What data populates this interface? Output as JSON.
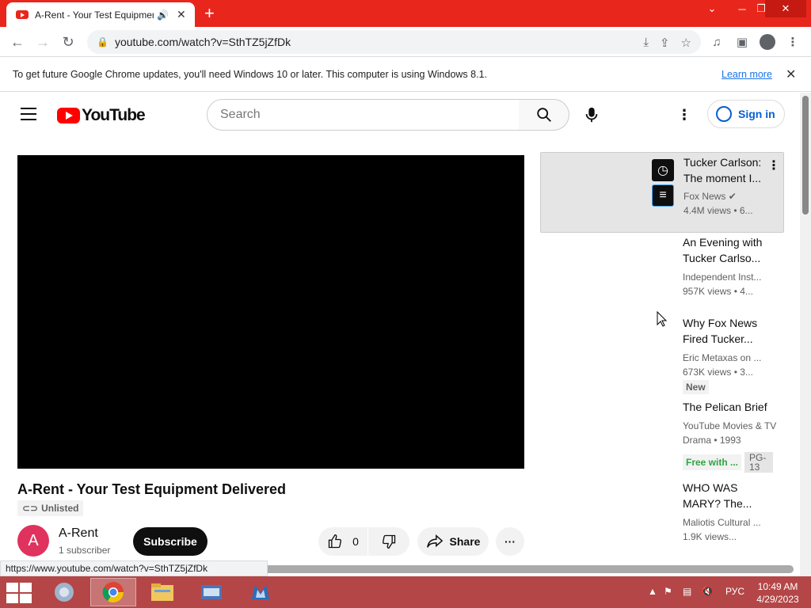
{
  "browser": {
    "tab_title": "A-Rent - Your Test Equipmen",
    "url": "youtube.com/watch?v=SthTZ5jZfDk",
    "status_url": "https://www.youtube.com/watch?v=SthTZ5jZfDk"
  },
  "infobar": {
    "message": "To get future Google Chrome updates, you'll need Windows 10 or later. This computer is using Windows 8.1.",
    "learn_more": "Learn more"
  },
  "yt_header": {
    "logo": "YouTube",
    "search_placeholder": "Search",
    "sign_in": "Sign in"
  },
  "video": {
    "title": "A-Rent - Your Test Equipment Delivered",
    "visibility": "Unlisted",
    "channel_initial": "A",
    "channel_name": "A-Rent",
    "subscribers": "1 subscriber",
    "subscribe_label": "Subscribe",
    "likes": "0",
    "share_label": "Share"
  },
  "recommendations": [
    {
      "title": "Tucker Carlson: The moment I...",
      "channel": "Fox News",
      "meta": "4.4M views • 6..."
    },
    {
      "title": "An Evening with Tucker Carlso...",
      "channel": "Independent Inst...",
      "meta": "957K views • 4..."
    },
    {
      "title": "Why Fox News Fired Tucker...",
      "channel": "Eric Metaxas on ...",
      "meta": "673K views • 3...",
      "badge": "New"
    },
    {
      "title": "The Pelican Brief",
      "channel": "YouTube Movies & TV",
      "meta": "Drama • 1993",
      "free_with": "Free with ...",
      "rating": "PG-13"
    },
    {
      "title": "WHO WAS MARY? The...",
      "channel": "Maliotis Cultural ...",
      "meta": "1.9K views..."
    }
  ],
  "taskbar": {
    "language": "РУС",
    "time": "10:49 AM",
    "date": "4/29/2023"
  },
  "colors": {
    "chrome_frame": "#e8261c",
    "youtube_red": "#ff0000",
    "link_blue": "#065fd4",
    "taskbar": "#b44647"
  }
}
